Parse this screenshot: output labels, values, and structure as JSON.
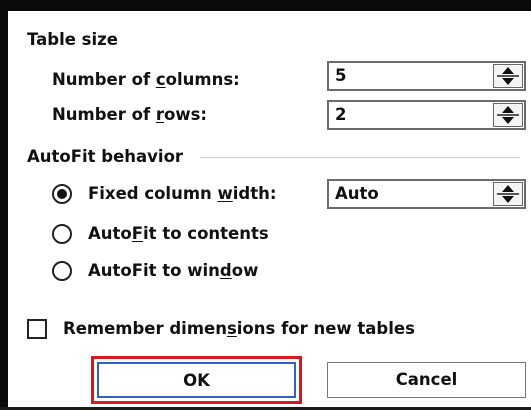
{
  "table_size": {
    "heading": "Table size",
    "columns": {
      "label_parts": [
        "Number of ",
        "c",
        "olumns:"
      ],
      "value": "5"
    },
    "rows": {
      "label_parts": [
        "Number of ",
        "r",
        "ows:"
      ],
      "value": "2"
    }
  },
  "autofit": {
    "heading": "AutoFit behavior",
    "options": [
      {
        "label_parts": [
          "Fixed column ",
          "w",
          "idth:"
        ],
        "checked": true
      },
      {
        "label_parts": [
          "Auto",
          "F",
          "it to contents"
        ],
        "checked": false
      },
      {
        "label_parts": [
          "AutoFit to win",
          "d",
          "ow"
        ],
        "checked": false
      }
    ],
    "fixed_width_value": "Auto"
  },
  "remember": {
    "label_parts": [
      "Remember dimen",
      "s",
      "ions for new tables"
    ],
    "checked": false
  },
  "buttons": {
    "ok": "OK",
    "cancel": "Cancel"
  },
  "colors": {
    "highlight_outline": "#d71920",
    "ok_border": "#2f62c8"
  }
}
